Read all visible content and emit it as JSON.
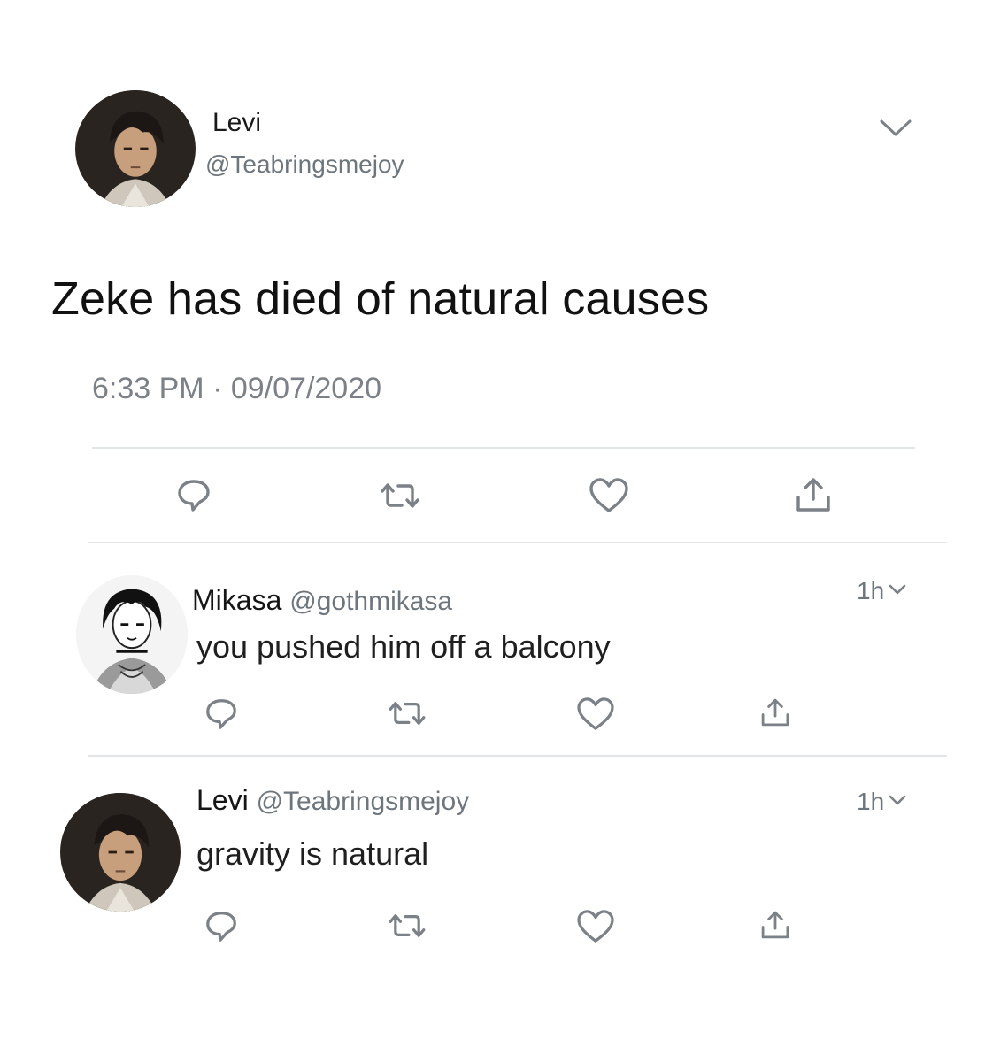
{
  "main_tweet": {
    "author_name": "Levi",
    "author_handle": "@Teabringsmejoy",
    "text": "Zeke has died of natural causes",
    "time": "6:33 PM",
    "separator": "·",
    "date": "09/07/2020",
    "avatar": "levi-avatar",
    "menu_icon": "chevron-down-icon",
    "actions": [
      "reply-icon",
      "retweet-icon",
      "like-icon",
      "share-icon"
    ]
  },
  "replies": [
    {
      "author_name": "Mikasa",
      "author_handle": "@gothmikasa",
      "text": "you pushed him off a balcony",
      "time": "1h",
      "avatar": "mikasa-avatar"
    },
    {
      "author_name": "Levi",
      "author_handle": "@Teabringsmejoy",
      "text": "gravity is natural",
      "time": "1h",
      "avatar": "levi-avatar"
    }
  ],
  "colors": {
    "text": "#111111",
    "muted": "#6e767d",
    "icon": "#6e767d",
    "divider": "#e3e6e8",
    "background": "#ffffff"
  }
}
